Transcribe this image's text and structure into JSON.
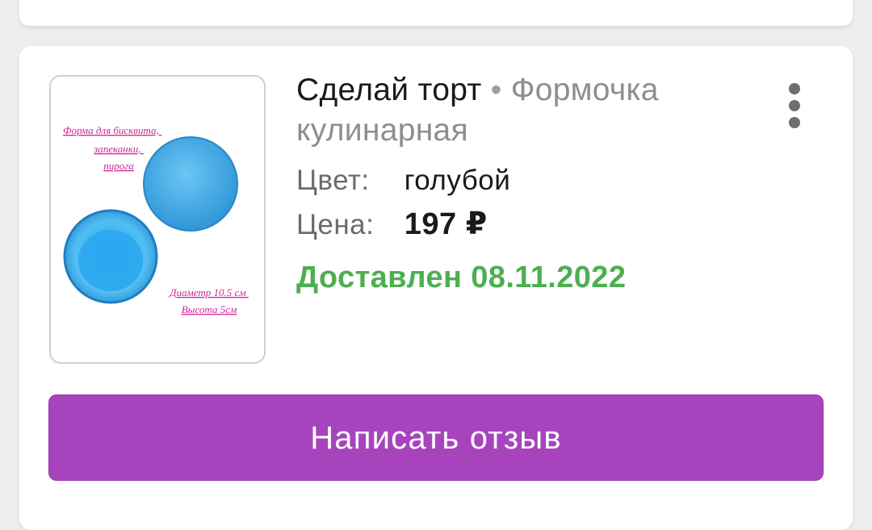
{
  "product": {
    "brand": "Сделай торт",
    "separator": "•",
    "name": "Формочка кулинарная",
    "color_label": "Цвет:",
    "color_value": "голубой",
    "price_label": "Цена:",
    "price_value": "197 ₽",
    "status": "Доставлен 08.11.2022",
    "image_caption_top": [
      "Форма для бисквита,",
      "запеканки,",
      "пирога"
    ],
    "image_caption_bottom": [
      "Диаметр 10.5 см",
      "Высота 5см"
    ]
  },
  "actions": {
    "more_icon": "more-vertical-icon",
    "review_label": "Написать отзыв"
  },
  "colors": {
    "accent": "#a744bd",
    "status_green": "#4caf50",
    "product_blue": "#3fa9e6",
    "caption_magenta": "#d0249a"
  }
}
